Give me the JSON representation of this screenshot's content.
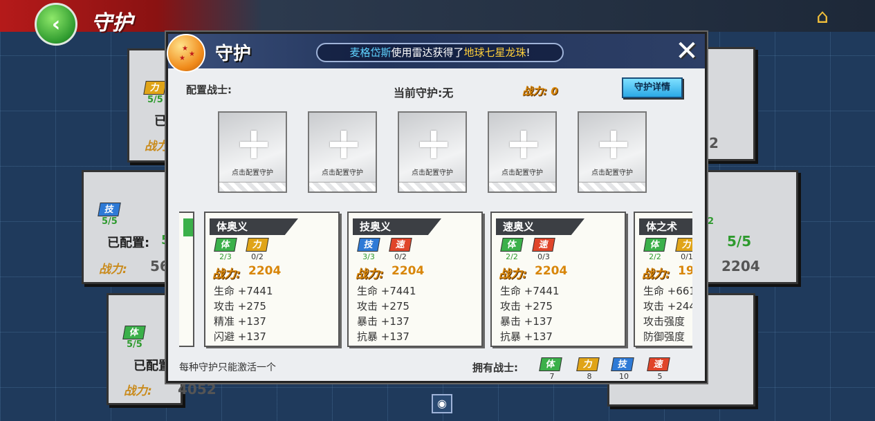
{
  "topbar": {
    "title": "守护",
    "back_icon": "‹",
    "home_icon": "⌂"
  },
  "background_cards": [
    {
      "badge": "力",
      "count": "5/5",
      "label": "已",
      "power_label": "战力"
    },
    {
      "badge": "技",
      "count": "5/5",
      "label": "已配置:",
      "value": "5",
      "power_label": "战力:",
      "power": "56"
    },
    {
      "badge": "体",
      "count": "5/5",
      "label": "已配置",
      "power_label": "战力:",
      "power": "4052"
    },
    {
      "value": "2"
    },
    {
      "count": "2",
      "value": "5/5",
      "power": "2204"
    }
  ],
  "modal": {
    "title": "守护",
    "notice": {
      "name": "麦格岱斯",
      "middle": "使用雷达获得了",
      "item": "地球七星龙珠",
      "end": "!"
    },
    "close_icon": "✕",
    "config_label": "配置战士:",
    "current_guard": "当前守护:无",
    "power_label": "战力:",
    "power_value": "0",
    "detail_button": "守护详情",
    "slot_text": "点击配置守护",
    "footer_note": "每种守护只能激活一个",
    "owned_label": "拥有战士:"
  },
  "cards": [
    {
      "title": "体奥义",
      "req": [
        {
          "type": "ti",
          "label": "体",
          "count": "2/3",
          "ok": true
        },
        {
          "type": "li",
          "label": "力",
          "count": "0/2",
          "ok": false
        }
      ],
      "power_label": "战力:",
      "power": "2204",
      "attrs": [
        "生命 +7441",
        "攻击 +275",
        "精准 +137",
        "闪避 +137"
      ]
    },
    {
      "title": "技奥义",
      "req": [
        {
          "type": "ji",
          "label": "技",
          "count": "3/3",
          "ok": true
        },
        {
          "type": "su",
          "label": "速",
          "count": "0/2",
          "ok": false
        }
      ],
      "power_label": "战力:",
      "power": "2204",
      "attrs": [
        "生命 +7441",
        "攻击 +275",
        "暴击 +137",
        "抗暴 +137"
      ]
    },
    {
      "title": "速奥义",
      "req": [
        {
          "type": "ti",
          "label": "体",
          "count": "2/2",
          "ok": true
        },
        {
          "type": "su",
          "label": "速",
          "count": "0/3",
          "ok": false
        }
      ],
      "power_label": "战力:",
      "power": "2204",
      "attrs": [
        "生命 +7441",
        "攻击 +275",
        "暴击 +137",
        "抗暴 +137"
      ]
    },
    {
      "title": "体之术",
      "req": [
        {
          "type": "ti",
          "label": "体",
          "count": "2/2",
          "ok": true
        },
        {
          "type": "li",
          "label": "力",
          "count": "0/1",
          "ok": false
        }
      ],
      "power_label": "战力:",
      "power": "19",
      "attrs": [
        "生命 +661",
        "攻击 +244",
        "攻击强度",
        "防御强度"
      ]
    }
  ],
  "owned": [
    {
      "type": "ti",
      "label": "体",
      "count": "7"
    },
    {
      "type": "li",
      "label": "力",
      "count": "8"
    },
    {
      "type": "ji",
      "label": "技",
      "count": "10"
    },
    {
      "type": "su",
      "label": "速",
      "count": "5"
    }
  ],
  "eye_icon": "◉"
}
